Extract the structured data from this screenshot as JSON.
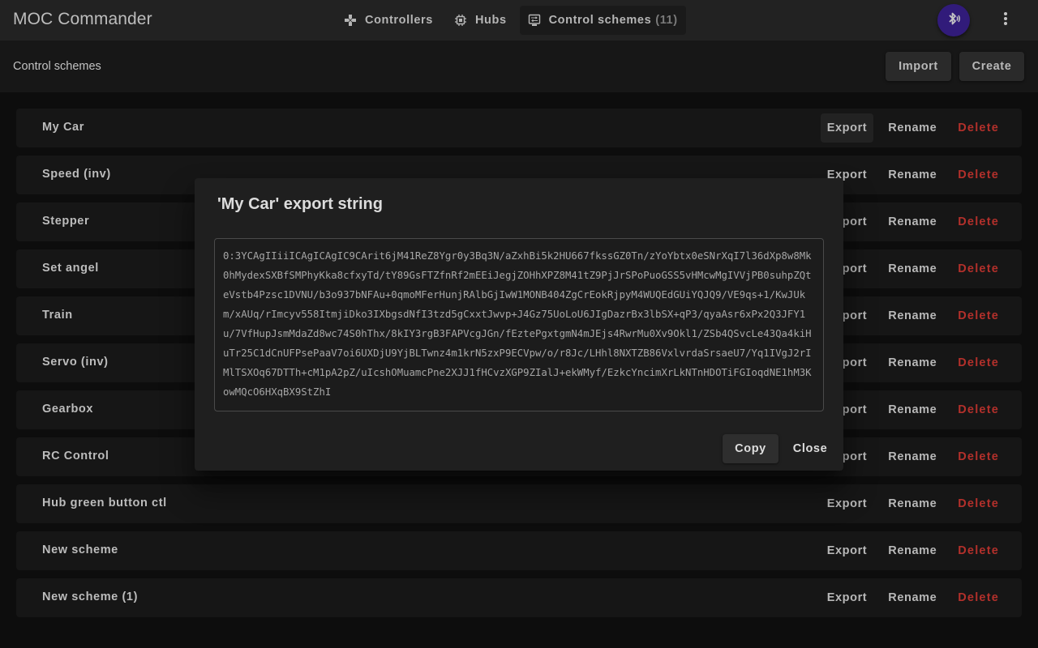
{
  "app": {
    "title": "MOC Commander"
  },
  "nav": {
    "items": [
      {
        "label": "Controllers",
        "icon": "gamepad-icon",
        "count": ""
      },
      {
        "label": "Hubs",
        "icon": "chip-icon",
        "count": ""
      },
      {
        "label": "Control schemes",
        "icon": "control-scheme-icon",
        "count": "(11)",
        "active": true
      }
    ],
    "bluetooth_icon": "bluetooth-searching-icon",
    "menu_icon": "more-vert-icon"
  },
  "toolbar": {
    "title": "Control schemes",
    "import_label": "Import",
    "create_label": "Create"
  },
  "schemes": {
    "action_labels": {
      "export": "Export",
      "rename": "Rename",
      "delete": "Delete"
    },
    "items": [
      {
        "name": "My Car"
      },
      {
        "name": "Speed (inv)"
      },
      {
        "name": "Stepper"
      },
      {
        "name": "Set angel"
      },
      {
        "name": "Train"
      },
      {
        "name": "Servo (inv)"
      },
      {
        "name": "Gearbox"
      },
      {
        "name": "RC Control"
      },
      {
        "name": "Hub green button ctl"
      },
      {
        "name": "New scheme"
      },
      {
        "name": "New scheme (1)"
      }
    ]
  },
  "dialog": {
    "title": "'My Car' export string",
    "export_string": "0:3YCAgIIiiICAgICAgIC9CArit6jM41ReZ8Ygr0y3Bq3N/aZxhBi5k2HU667fkssGZ0Tn/zYoYbtx0eSNrXqI7l36dXp8w8Mk0hMydexSXBfSMPhyKka8cfxyTd/tY89GsFTZfnRf2mEEiJegjZOHhXPZ8M41tZ9PjJrSPoPuoGSS5vHMcwMgIVVjPB0suhpZQteVstb4Pzsc1DVNU/b3o937bNFAu+0qmoMFerHunjRAlbGjIwW1MONB404ZgCrEokRjpyM4WUQEdGUiYQJQ9/VE9qs+1/KwJUkm/xAUq/rImcyv558ItmjiDko3IXbgsdNfI3tzd5gCxxtJwvp+J4Gz75UoLoU6JIgDazrBx3lbSX+qP3/qyaAsr6xPx2Q3JFY1u/7VfHupJsmMdaZd8wc74S0hThx/8kIY3rgB3FAPVcgJGn/fEztePgxtgmN4mJEjs4RwrMu0Xv9Okl1/ZSb4QSvcLe43Qa4kiHuTr25C1dCnUFPsePaaV7oi6UXDjU9YjBLTwnz4m1krN5zxP9ECVpw/o/r8Jc/LHhl8NXTZB86VxlvrdaSrsaeU7/Yq1IVgJ2rIMlTSXOq67DTTh+cM1pA2pZ/uIcshOMuamcPne2XJJ1fHCvzXGP9ZIalJ+ekWMyf/EzkcYncimXrLkNTnHDOTiFGIoqdNE1hM3KowMQcO6HXqBX9StZhI",
    "copy_label": "Copy",
    "close_label": "Close"
  },
  "colors": {
    "accent_bluetooth": "#311b7a",
    "delete": "#b3302b"
  }
}
